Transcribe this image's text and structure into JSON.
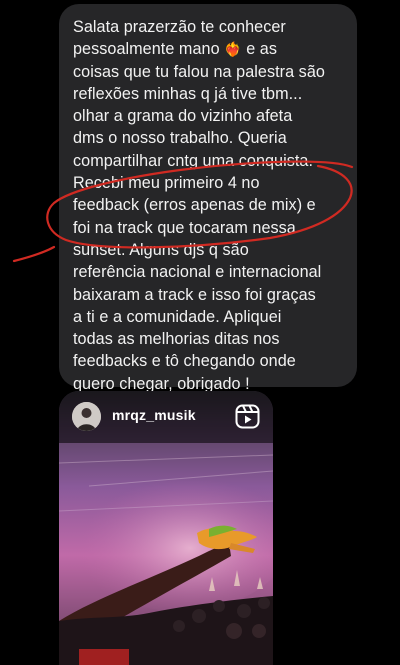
{
  "message": {
    "text_part1": "Salata prazerzão te conhecer\npessoalmente mano ",
    "emoji_icon": "heart-on-fire-emoji",
    "text_part2": " e as\ncoisas que tu falou na palestra são\nreflexões minhas q já tive tbm...\nolhar a grama do vizinho afeta\ndms o nosso trabalho. Queria\ncompartilhar cntg uma conquista.\nRecebi meu primeiro 4 no\nfeedback (erros apenas de mix) e\nfoi na track que tocaram nessa\nsunset. Alguns djs q são\nreferência nacional e internacional\nbaixaram a track e isso foi graças\na ti e a comunidade. Apliquei\ntodas as melhorias ditas nos\nfeedbacks e tô chegando onde\nquero chegar, obrigado !"
  },
  "shared_reel": {
    "username": "mrqz_musik",
    "icon": "instagram-reels-icon"
  },
  "colors": {
    "background": "#000000",
    "bubble": "#262628",
    "text": "#f2f2f2",
    "annotation": "#d02a22"
  }
}
